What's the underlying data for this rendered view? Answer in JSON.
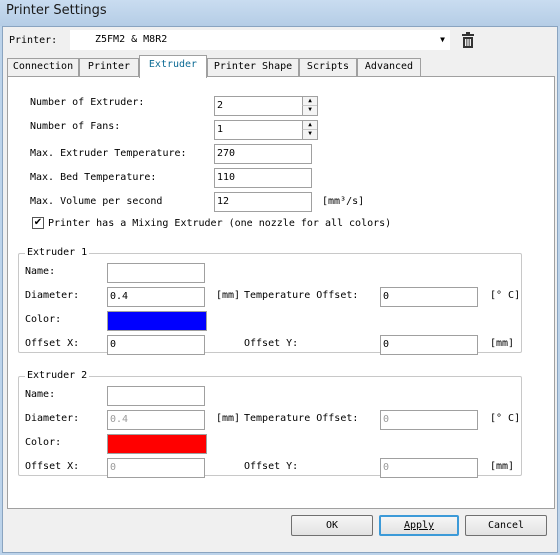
{
  "window": {
    "title": "Printer Settings"
  },
  "printer": {
    "label": "Printer:",
    "selected": "Z5FM2 & M8R2",
    "dropdown_icon": "chevron-down-icon",
    "delete_icon": "trash-icon"
  },
  "tabs": [
    {
      "label": "Connection",
      "active": false
    },
    {
      "label": "Printer",
      "active": false
    },
    {
      "label": "Extruder",
      "active": true
    },
    {
      "label": "Printer Shape",
      "active": false
    },
    {
      "label": "Scripts",
      "active": false
    },
    {
      "label": "Advanced",
      "active": false
    }
  ],
  "extruder_settings": {
    "num_extruders": {
      "label": "Number of Extruder:",
      "value": "2"
    },
    "num_fans": {
      "label": "Number of Fans:",
      "value": "1"
    },
    "max_extruder_temp": {
      "label": "Max. Extruder Temperature:",
      "value": "270"
    },
    "max_bed_temp": {
      "label": "Max. Bed Temperature:",
      "value": "110"
    },
    "max_volume": {
      "label": "Max. Volume per second",
      "value": "12",
      "unit": "[mm³/s]"
    },
    "mixing": {
      "label": "Printer has a Mixing Extruder (one nozzle for all colors)",
      "checked": true
    }
  },
  "extruders": [
    {
      "title": "Extruder 1",
      "name_label": "Name:",
      "name_value": "",
      "diameter_label": "Diameter:",
      "diameter_value": "0.4",
      "diameter_unit": "[mm]",
      "temp_offset_label": "Temperature Offset:",
      "temp_offset_value": "0",
      "temp_unit": "[° C]",
      "color_label": "Color:",
      "color": "#0000ff",
      "offset_x_label": "Offset X:",
      "offset_x_value": "0",
      "offset_y_label": "Offset Y:",
      "offset_y_value": "0",
      "offset_unit": "[mm]",
      "disabled": false
    },
    {
      "title": "Extruder 2",
      "name_label": "Name:",
      "name_value": "",
      "diameter_label": "Diameter:",
      "diameter_value": "0.4",
      "diameter_unit": "[mm]",
      "temp_offset_label": "Temperature Offset:",
      "temp_offset_value": "0",
      "temp_unit": "[° C]",
      "color_label": "Color:",
      "color": "#ff0000",
      "offset_x_label": "Offset X:",
      "offset_x_value": "0",
      "offset_y_label": "Offset Y:",
      "offset_y_value": "0",
      "offset_unit": "[mm]",
      "disabled": true
    }
  ],
  "buttons": {
    "ok": "OK",
    "apply": "Apply",
    "cancel": "Cancel"
  }
}
